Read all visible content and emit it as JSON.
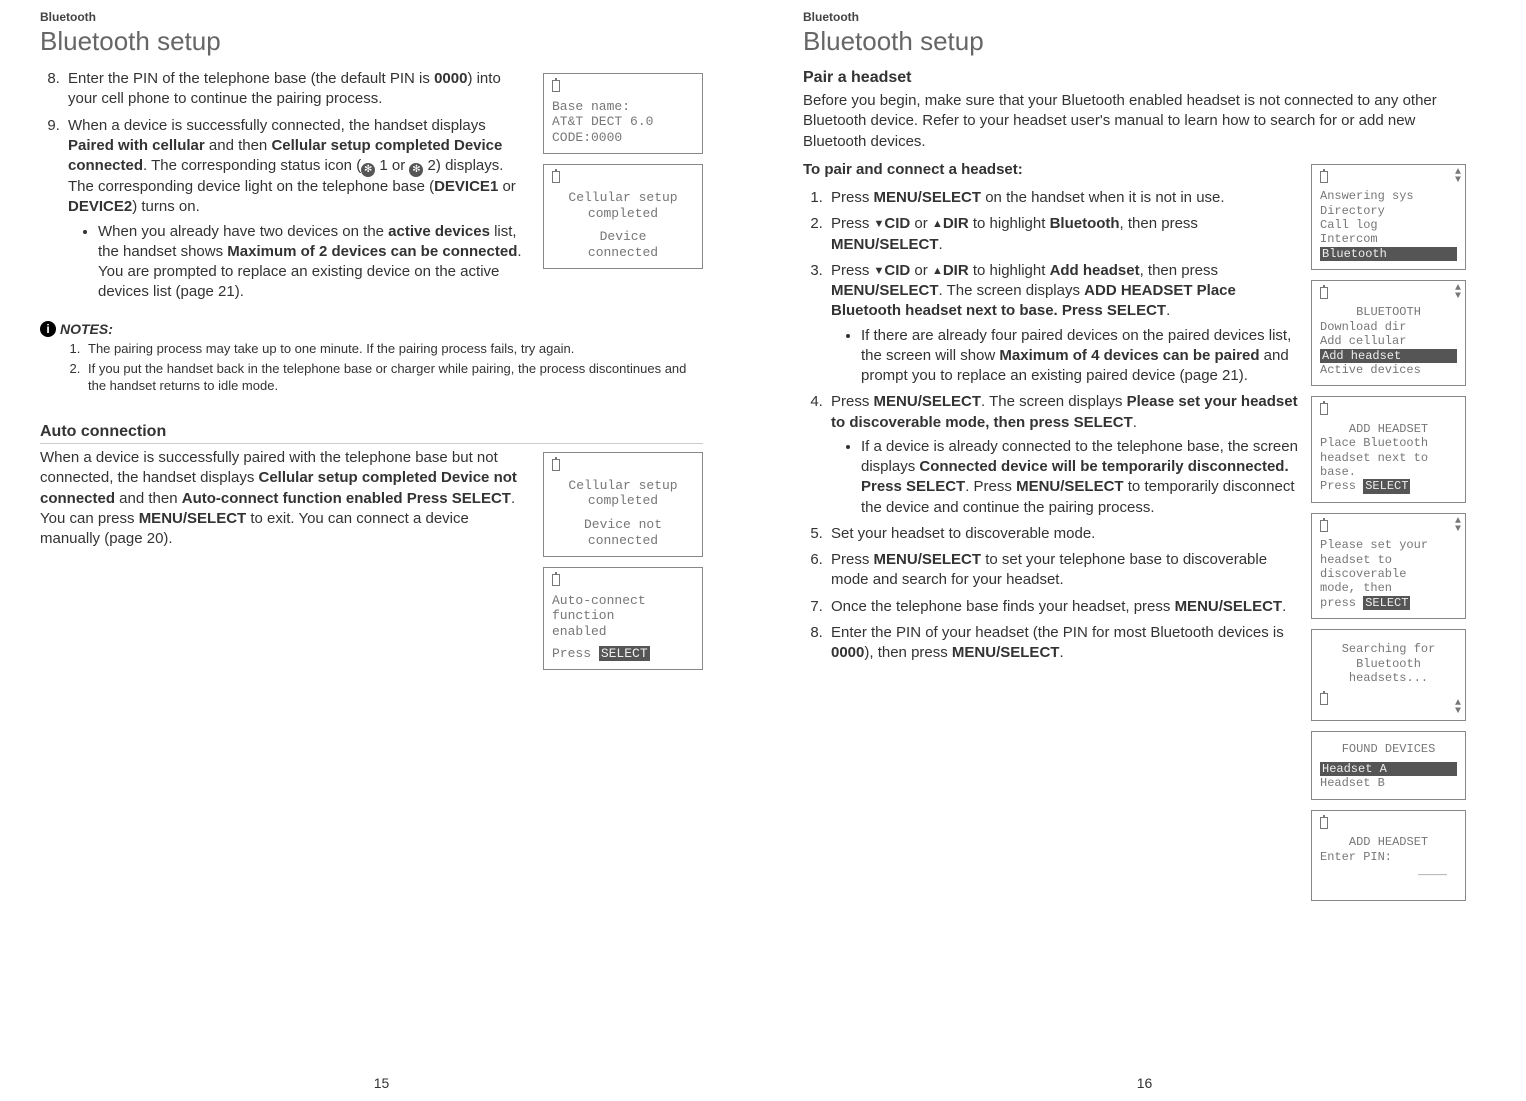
{
  "left": {
    "header": "Bluetooth",
    "title": "Bluetooth setup",
    "step8": {
      "num": "8.",
      "pre": "Enter the PIN of the telephone base (the default PIN is ",
      "pin": "0000",
      "post": ") into your cell phone to continue the pairing process."
    },
    "step9": {
      "num": "9.",
      "t1": "When a device is successfully connected, the handset displays ",
      "b1": "Paired with cellular",
      "t2": " and then ",
      "b2": "Cellular setup completed Device connected",
      "t3": ". The corresponding status icon (",
      "bt1": "✻",
      "t4": " 1 or ",
      "bt2": "✻",
      "t5": " 2) displays. The corresponding device light on the telephone base (",
      "b3": "DEVICE1",
      "t6": " or ",
      "b4": "DEVICE2",
      "t7": ") turns on."
    },
    "bullet": {
      "t1": "When you already have two devices on the ",
      "b1": "active devices",
      "t2": " list, the handset shows ",
      "b2": "Maximum of 2 devices can be connected",
      "t3": ". You are prompted to replace an existing device on the active devices list (page 21)."
    },
    "notesLabel": "NOTES:",
    "note1": "The pairing process may take up to one minute. If the pairing process fails, try again.",
    "note2": "If you put the handset back in the telephone base or charger while pairing, the process discontinues and the handset returns to idle mode.",
    "autoHead": "Auto connection",
    "auto": {
      "t1": "When a device is successfully paired with the telephone base but not connected, the handset displays ",
      "b1": "Cellular setup completed Device not connected",
      "t2": " and then ",
      "b2": "Auto-connect function enabled Press SELECT",
      "t3": ". You can press ",
      "k1": "MENU",
      "b3": "/SELECT",
      "t4": " to exit. You can connect a device manually (page 20)."
    },
    "lcd1": {
      "l1": "Base name:",
      "l2": "AT&T DECT 6.0",
      "l3": "CODE:0000"
    },
    "lcd2": {
      "l1": "Cellular setup",
      "l2": "completed",
      "l3": "Device",
      "l4": "connected"
    },
    "lcd3": {
      "l1": "Cellular setup",
      "l2": "completed",
      "l3": "Device not",
      "l4": "connected"
    },
    "lcd4": {
      "l1": "Auto-connect",
      "l2": "function",
      "l3": "enabled",
      "l4pre": "Press ",
      "l4sel": "SELECT"
    },
    "pageNum": "15"
  },
  "right": {
    "header": "Bluetooth",
    "title": "Bluetooth setup",
    "pairHead": "Pair a headset",
    "intro": "Before you begin, make sure that your Bluetooth enabled headset is not connected to any other Bluetooth device. Refer to your headset user's manual to learn how to search for or add new Bluetooth devices.",
    "toPair": "To pair and connect a headset:",
    "s1": {
      "t1": "Press ",
      "k1": "MENU/",
      "k2": "SELECT",
      "t2": " on the handset when it is not in use."
    },
    "s2": {
      "t1": "Press ",
      "d1": "▼",
      "b1": "CID",
      "t2": " or ",
      "d2": "▲",
      "b2": "DIR",
      "t3": " to highlight ",
      "b3": "Bluetooth",
      "t4": ", then press ",
      "k1": "MENU",
      "b4": "/SELECT",
      "t5": "."
    },
    "s3": {
      "t1": "Press ",
      "d1": "▼",
      "b1": "CID",
      "t2": " or ",
      "d2": "▲",
      "b2": "DIR",
      "t3": " to highlight ",
      "b3": "Add headset",
      "t4": ", then press ",
      "k1": "MENU",
      "b4": "/SELECT",
      "t5": ". The screen displays ",
      "b5": "ADD HEADSET Place Bluetooth headset next to base. Press SELECT",
      "t6": "."
    },
    "s3b": {
      "t1": "If there are already four paired devices on the paired devices list, the screen will show ",
      "b1": "Maximum of 4 devices can be paired",
      "t2": " and prompt you to replace an existing paired device (page 21)."
    },
    "s4": {
      "t1": "Press ",
      "k1": "MENU",
      "b1": "/SELECT",
      "t2": ". The screen displays ",
      "b2": "Please set your headset to discoverable mode, then press SELECT",
      "t3": "."
    },
    "s4b": {
      "t1": "If a device is already connected to the telephone base, the screen displays ",
      "b1": "Connected device will be temporarily disconnected. Press SELECT",
      "t2": ". Press ",
      "k1": "MENU",
      "b2": "/SELECT",
      "t3": " to temporarily disconnect the device and continue the pairing process."
    },
    "s5": "Set your headset to discoverable mode.",
    "s6": {
      "t1": "Press ",
      "k1": "MENU",
      "b1": "/SELECT",
      "t2": " to set your telephone base to discoverable mode and search for your headset."
    },
    "s7": {
      "t1": "Once the telephone base finds your headset, press ",
      "k1": "MENU",
      "b1": "/SELECT",
      "t2": "."
    },
    "s8": {
      "t1": "Enter the PIN of your headset (the PIN for most Bluetooth devices is ",
      "b1": "0000",
      "t2": "), then press ",
      "k1": "MENU",
      "b2": "/SELECT",
      "t3": "."
    },
    "lcdMenu": {
      "l1": "Answering sys",
      "l2": "Directory",
      "l3": "Call log",
      "l4": "Intercom",
      "l5": "Bluetooth"
    },
    "lcdBt": {
      "title": "BLUETOOTH",
      "l1": "Download dir",
      "l2": "Add cellular",
      "sel": "Add headset",
      "l3": "Active devices"
    },
    "lcdAdd": {
      "title": "ADD HEADSET",
      "l1": "Place Bluetooth",
      "l2": "headset next to",
      "l3": "base.",
      "l4pre": "Press ",
      "l4sel": "SELECT"
    },
    "lcdDisc": {
      "l1": "Please set your",
      "l2": "headset to",
      "l3": "discoverable",
      "l4": "mode, then",
      "l5pre": "press ",
      "l5sel": "SELECT"
    },
    "lcdSearch": {
      "l1": "Searching for",
      "l2": "Bluetooth",
      "l3": "headsets..."
    },
    "lcdFound": {
      "title": "FOUND DEVICES",
      "sel": "Headset A",
      "l1": "Headset B"
    },
    "lcdPin": {
      "title": "ADD HEADSET",
      "l1": "Enter PIN:",
      "l2": "____"
    },
    "pageNum": "16"
  }
}
